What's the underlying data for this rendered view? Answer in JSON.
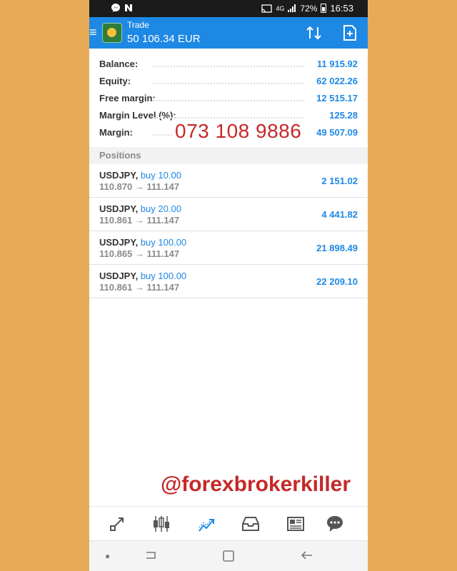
{
  "statusbar": {
    "left_icons": [
      "messenger-icon",
      "n-icon"
    ],
    "battery": "72%",
    "time": "16:53",
    "network": "4G"
  },
  "appbar": {
    "title": "Trade",
    "balance": "50 106.34 EUR"
  },
  "account": {
    "rows": [
      {
        "label": "Balance:",
        "value": "11 915.92"
      },
      {
        "label": "Equity:",
        "value": "62 022.26"
      },
      {
        "label": "Free margin:",
        "value": "12 515.17"
      },
      {
        "label": "Margin Level (%):",
        "value": "125.28"
      },
      {
        "label": "Margin:",
        "value": "49 507.09"
      }
    ]
  },
  "overlay_text": "073 108 9886",
  "positions": {
    "header": "Positions",
    "items": [
      {
        "symbol": "USDJPY,",
        "side": "buy 10.00",
        "prices": "110.870 → 111.147",
        "profit": "2 151.02"
      },
      {
        "symbol": "USDJPY,",
        "side": "buy 20.00",
        "prices": "110.861 → 111.147",
        "profit": "4 441.82"
      },
      {
        "symbol": "USDJPY,",
        "side": "buy 100.00",
        "prices": "110.865 → 111.147",
        "profit": "21 898.49"
      },
      {
        "symbol": "USDJPY,",
        "side": "buy 100.00",
        "prices": "110.861 → 111.147",
        "profit": "22 209.10"
      }
    ]
  },
  "watermark": "@forexbrokerkiller",
  "bottom_nav": [
    "quotes-icon",
    "chart-icon",
    "trade-icon",
    "history-icon",
    "news-icon",
    "chat-icon"
  ],
  "colors": {
    "accent": "#1E88E5",
    "overlay": "#c62828",
    "background": "#E8AB55"
  }
}
